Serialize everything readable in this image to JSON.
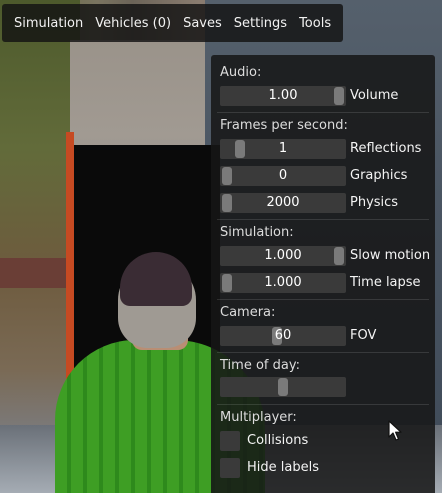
{
  "menu": {
    "items": [
      "Simulation",
      "Vehicles (0)",
      "Saves",
      "Settings",
      "Tools"
    ]
  },
  "panel": {
    "audio": {
      "title": "Audio:",
      "volume": {
        "value": "1.00",
        "label": "Volume",
        "level": 1.0
      }
    },
    "fps": {
      "title": "Frames per second:",
      "reflections": {
        "value": "1",
        "label": "Reflections",
        "level": 0.12
      },
      "graphics": {
        "value": "0",
        "label": "Graphics",
        "level": 0.0
      },
      "physics": {
        "value": "2000",
        "label": "Physics",
        "level": 0.0
      }
    },
    "simulation": {
      "title": "Simulation:",
      "slow_motion": {
        "value": "1.000",
        "label": "Slow motion",
        "level": 1.0
      },
      "time_lapse": {
        "value": "1.000",
        "label": "Time lapse",
        "level": 0.0
      }
    },
    "camera": {
      "title": "Camera:",
      "fov": {
        "value": "60",
        "label": "FOV",
        "level": 0.45
      }
    },
    "time_of_day": {
      "title": "Time of day:",
      "level": 0.5
    },
    "multiplayer": {
      "title": "Multiplayer:",
      "collisions": {
        "label": "Collisions",
        "checked": false
      },
      "hide_labels": {
        "label": "Hide labels",
        "checked": false
      }
    }
  },
  "icons": {
    "cursor": "arrow-cursor-icon"
  },
  "colors": {
    "panel_bg": "#161616",
    "slider_bg": "#3a3a3a",
    "handle": "#7a7a7a"
  }
}
